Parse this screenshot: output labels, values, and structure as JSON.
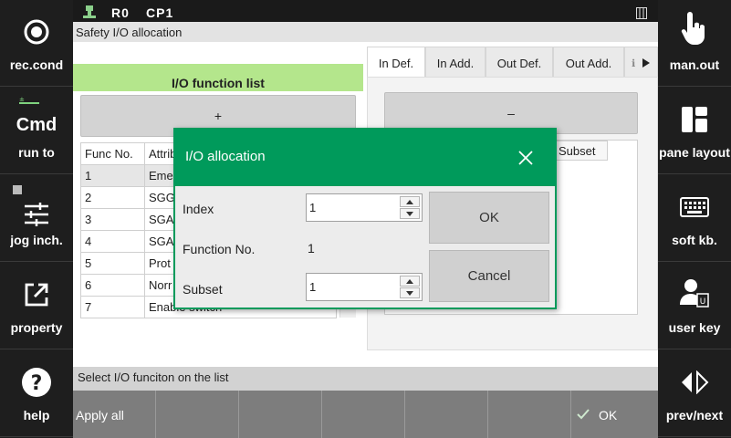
{
  "status": {
    "robot": "R0",
    "cp": "CP1"
  },
  "window_title": "Safety I/O allocation",
  "left_sidebar": [
    {
      "label": "rec.cond",
      "icon": "record-icon"
    },
    {
      "label": "run to",
      "icon": "cmd-run-to-icon",
      "icon_text": "Cmd"
    },
    {
      "label": "jog inch.",
      "icon": "sliders-icon"
    },
    {
      "label": "property",
      "icon": "external-link-icon"
    },
    {
      "label": "help",
      "icon": "help-icon"
    }
  ],
  "right_sidebar": [
    {
      "label": "man.out",
      "icon": "hand-pointer-icon"
    },
    {
      "label": "pane layout",
      "icon": "pane-layout-icon"
    },
    {
      "label": "soft kb.",
      "icon": "keyboard-icon"
    },
    {
      "label": "user key",
      "icon": "user-key-icon"
    },
    {
      "label": "prev/next",
      "icon": "prev-next-icon"
    }
  ],
  "io_list": {
    "header": "I/O function list",
    "add_label": "+",
    "columns": [
      "Func No.",
      "Attrib"
    ],
    "rows": [
      {
        "no": "1",
        "attr": "Eme"
      },
      {
        "no": "2",
        "attr": "SGG"
      },
      {
        "no": "3",
        "attr": "SGA"
      },
      {
        "no": "4",
        "attr": "SGA"
      },
      {
        "no": "5",
        "attr": "Prot"
      },
      {
        "no": "6",
        "attr": "Norr"
      },
      {
        "no": "7",
        "attr": "Enable switch"
      }
    ]
  },
  "tabs": [
    {
      "label": "In Def.",
      "active": true
    },
    {
      "label": "In Add.",
      "active": false
    },
    {
      "label": "Out Def.",
      "active": false
    },
    {
      "label": "Out Add.",
      "active": false
    }
  ],
  "right_panel": {
    "remove_label": "–",
    "subset_header": "Subset"
  },
  "status_message": "Select I/O funciton on the list",
  "bottom": {
    "apply_all": "Apply all",
    "ok": "OK"
  },
  "dialog": {
    "title": "I/O allocation",
    "index_label": "Index",
    "index_value": "1",
    "function_label": "Function No.",
    "function_value": "1",
    "subset_label": "Subset",
    "subset_value": "1",
    "ok_label": "OK",
    "cancel_label": "Cancel"
  },
  "colors": {
    "accent": "#009a5b",
    "header_green": "#b4e68c"
  }
}
